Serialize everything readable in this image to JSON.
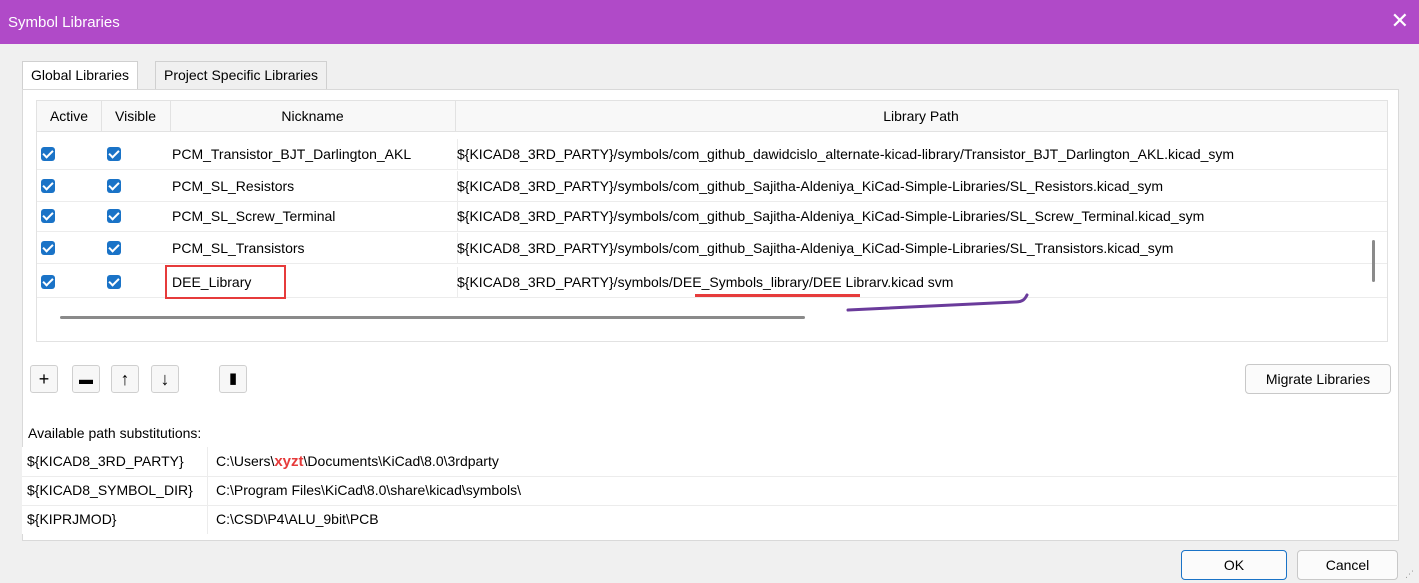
{
  "window": {
    "title": "Symbol Libraries",
    "close": "✕"
  },
  "tabs": [
    "Global Libraries",
    "Project Specific Libraries"
  ],
  "table": {
    "columns": [
      "Active",
      "Visible",
      "Nickname",
      "Library Path"
    ],
    "rows": [
      {
        "active": true,
        "visible": true,
        "nickname": "PCM_Transistor_BJT_Darlington_AKL",
        "path": "${KICAD8_3RD_PARTY}/symbols/com_github_dawidcislo_alternate-kicad-library/Transistor_BJT_Darlington_AKL.kicad_sym"
      },
      {
        "active": true,
        "visible": true,
        "nickname": "PCM_SL_Resistors",
        "path": "${KICAD8_3RD_PARTY}/symbols/com_github_Sajitha-Aldeniya_KiCad-Simple-Libraries/SL_Resistors.kicad_sym"
      },
      {
        "active": true,
        "visible": true,
        "nickname": "PCM_SL_Screw_Terminal",
        "path": "${KICAD8_3RD_PARTY}/symbols/com_github_Sajitha-Aldeniya_KiCad-Simple-Libraries/SL_Screw_Terminal.kicad_sym"
      },
      {
        "active": true,
        "visible": true,
        "nickname": "PCM_SL_Transistors",
        "path": "${KICAD8_3RD_PARTY}/symbols/com_github_Sajitha-Aldeniya_KiCad-Simple-Libraries/SL_Transistors.kicad_sym"
      },
      {
        "active": true,
        "visible": true,
        "nickname": "DEE_Library",
        "path_prefix": "${KICAD8_3RD_PARTY}/symbols/",
        "path_highlight": "DEE_Symbols_library",
        "path_suffix": "/DEE Librarv.kicad svm"
      }
    ]
  },
  "toolbar": {
    "add": "+",
    "folder": "▬",
    "up": "↑",
    "down": "↓",
    "delete": "▮"
  },
  "migrate_label": "Migrate Libraries",
  "substitutions": {
    "label": "Available path substitutions:",
    "rows": [
      {
        "key": "${KICAD8_3RD_PARTY}",
        "pre": "C:\\Users\\",
        "highlight": "xyzt",
        "post": "\\Documents\\KiCad\\8.0\\3rdparty"
      },
      {
        "key": "${KICAD8_SYMBOL_DIR}",
        "value": "C:\\Program Files\\KiCad\\8.0\\share\\kicad\\symbols\\"
      },
      {
        "key": "${KIPRJMOD}",
        "value": "C:\\CSD\\P4\\ALU_9bit\\PCB"
      }
    ]
  },
  "buttons": {
    "ok": "OK",
    "cancel": "Cancel"
  },
  "colors": {
    "titlebar": "#b04ac8",
    "checkbox": "#1a73c7",
    "annotation_red": "#e63b3b",
    "annotation_purple": "#6a3b9b"
  }
}
